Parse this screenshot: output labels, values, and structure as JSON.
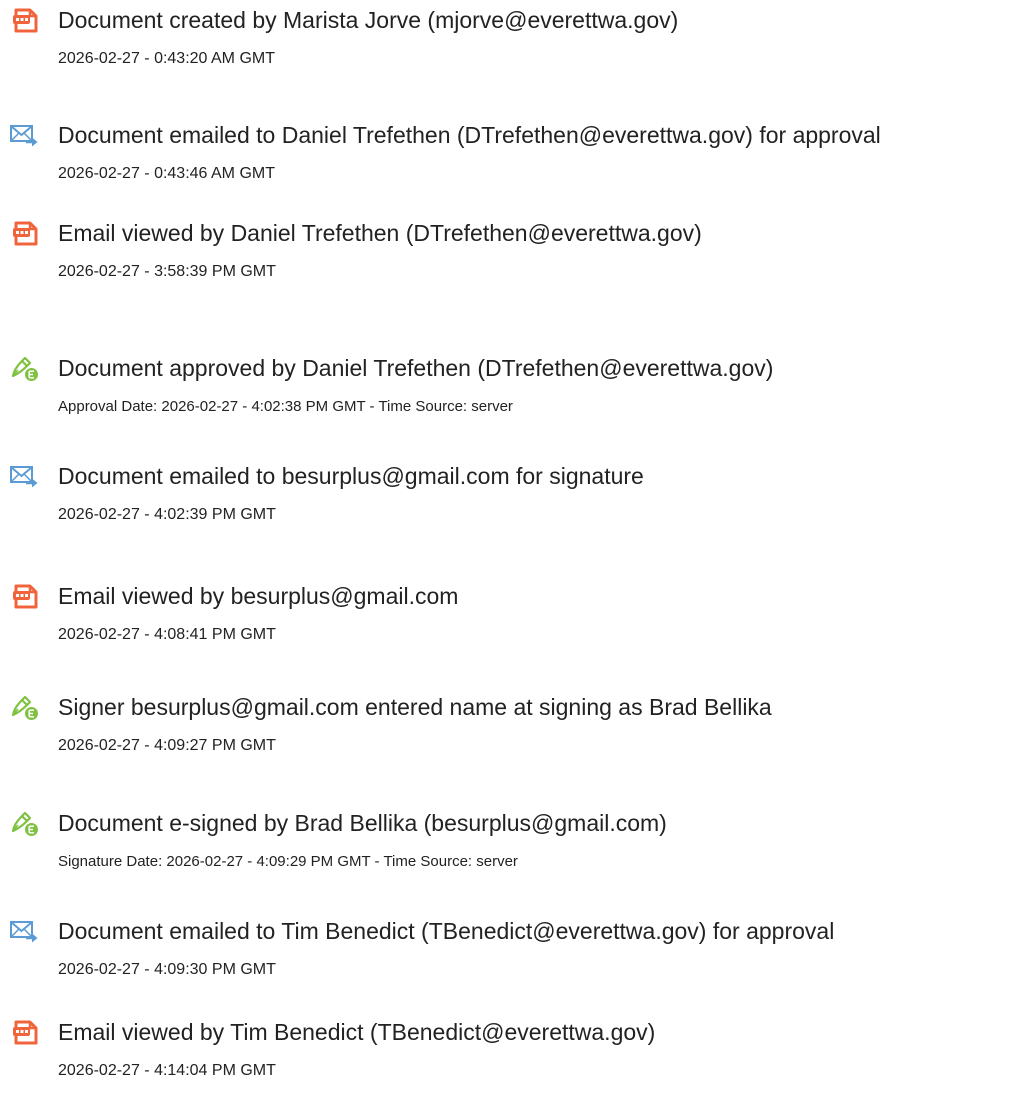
{
  "entries": [
    {
      "icon": "document-icon",
      "title": "Document created by Marista Jorve (mjorve@everettwa.gov)",
      "detail": "2026-02-27 - 0:43:20 AM GMT"
    },
    {
      "icon": "email-sent-icon",
      "title": "Document emailed to Daniel Trefethen (DTrefethen@everettwa.gov) for approval",
      "detail": "2026-02-27 - 0:43:46 AM GMT"
    },
    {
      "icon": "document-icon",
      "title": "Email viewed by Daniel Trefethen (DTrefethen@everettwa.gov)",
      "detail": "2026-02-27 - 3:58:39 PM GMT"
    },
    {
      "icon": "esign-pen-icon",
      "title": "Document approved by Daniel Trefethen (DTrefethen@everettwa.gov)",
      "detail": "Approval Date: 2026-02-27 - 4:02:38 PM GMT - Time Source: server"
    },
    {
      "icon": "email-sent-icon",
      "title": "Document emailed to besurplus@gmail.com for signature",
      "detail": "2026-02-27 - 4:02:39 PM GMT"
    },
    {
      "icon": "document-icon",
      "title": "Email viewed by besurplus@gmail.com",
      "detail": "2026-02-27 - 4:08:41 PM GMT"
    },
    {
      "icon": "esign-pen-icon",
      "title": "Signer besurplus@gmail.com entered name at signing as Brad Bellika",
      "detail": "2026-02-27 - 4:09:27 PM GMT"
    },
    {
      "icon": "esign-pen-icon",
      "title": "Document e-signed by Brad Bellika (besurplus@gmail.com)",
      "detail": "Signature Date: 2026-02-27 - 4:09:29 PM GMT - Time Source: server"
    },
    {
      "icon": "email-sent-icon",
      "title": "Document emailed to Tim Benedict (TBenedict@everettwa.gov) for approval",
      "detail": "2026-02-27 - 4:09:30 PM GMT"
    },
    {
      "icon": "document-icon",
      "title": "Email viewed by Tim Benedict (TBenedict@everettwa.gov)",
      "detail": "2026-02-27 - 4:14:04 PM GMT"
    }
  ],
  "colors": {
    "document_icon": "#f0643c",
    "email_icon": "#5b9bd5",
    "pen_icon": "#7fc241",
    "text": "#222222"
  }
}
